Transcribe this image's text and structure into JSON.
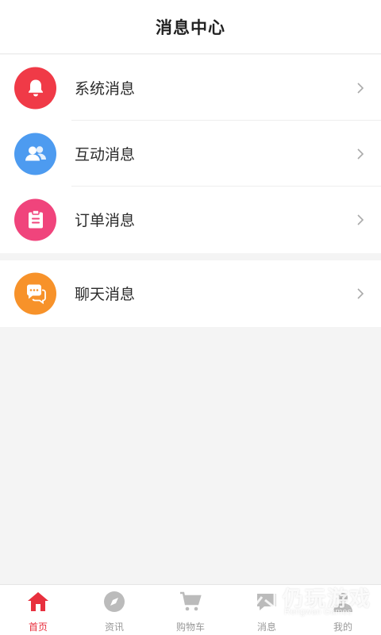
{
  "header": {
    "title": "消息中心"
  },
  "groups": [
    {
      "items": [
        {
          "label": "系统消息",
          "icon": "bell-icon",
          "color": "#f03a47"
        },
        {
          "label": "互动消息",
          "icon": "users-icon",
          "color": "#4d9bf0"
        },
        {
          "label": "订单消息",
          "icon": "clipboard-icon",
          "color": "#f0447c"
        }
      ]
    },
    {
      "items": [
        {
          "label": "聊天消息",
          "icon": "chat-icon",
          "color": "#f7922a"
        }
      ]
    }
  ],
  "tabbar": {
    "active": "首页",
    "tabs": [
      {
        "label": "首页",
        "icon": "home-icon"
      },
      {
        "label": "资讯",
        "icon": "compass-icon"
      },
      {
        "label": "购物车",
        "icon": "cart-icon"
      },
      {
        "label": "消息",
        "icon": "message-icon"
      },
      {
        "label": "我的",
        "icon": "user-icon"
      }
    ]
  },
  "watermark": {
    "text": "仍玩游戏",
    "sub": "Rengwan Games"
  },
  "colors": {
    "accent": "#e8303e",
    "inactive": "#bbbbbb",
    "background": "#f4f4f4"
  }
}
